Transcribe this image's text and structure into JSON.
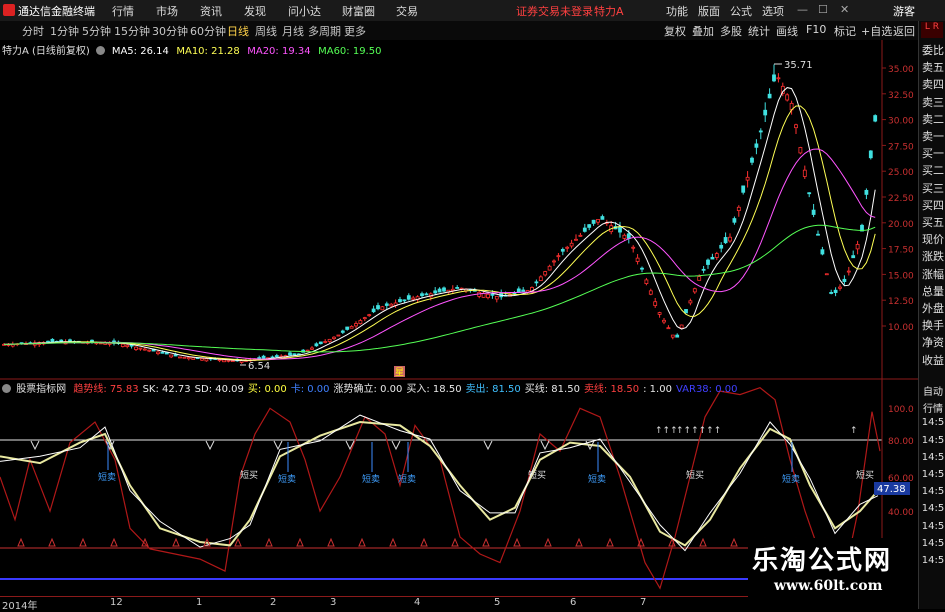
{
  "topbar": {
    "app_title": "通达信金融终端",
    "menu": [
      "行情",
      "市场",
      "资讯",
      "发现",
      "问小达",
      "财富圈",
      "交易"
    ],
    "login_status": "证券交易未登录",
    "stock_name": "特力A",
    "right_menu": [
      "功能",
      "版面",
      "公式",
      "选项"
    ],
    "guest": "游客"
  },
  "periods": [
    "分时",
    "1分钟",
    "5分钟",
    "15分钟",
    "30分钟",
    "60分钟",
    "日线",
    "周线",
    "月线",
    "多周期",
    "更多"
  ],
  "active_period": "日线",
  "tools": [
    "复权",
    "叠加",
    "多股",
    "统计",
    "画线",
    "F10",
    "标记",
    "+自选",
    "返回"
  ],
  "main_chart": {
    "title": "特力A (日线前复权)",
    "ma": [
      {
        "label": "MA5: 26.14",
        "color": "#ffffff"
      },
      {
        "label": "MA10: 21.28",
        "color": "#ffff55"
      },
      {
        "label": "MA20: 19.34",
        "color": "#ff55ff"
      },
      {
        "label": "MA60: 19.50",
        "color": "#55ff55"
      }
    ],
    "high_label": "35.71",
    "low_label": "6.54",
    "event_marker": "星",
    "y_ticks": [
      "35.00",
      "32.50",
      "30.00",
      "27.50",
      "25.00",
      "22.50",
      "20.00",
      "17.50",
      "15.00",
      "12.50",
      "10.00"
    ]
  },
  "indicator": {
    "name": "股票指标网",
    "items": [
      {
        "label": "趋势线: 75.83",
        "color": "#ff4040"
      },
      {
        "label": "SK: 42.73",
        "color": "#e8e8e8"
      },
      {
        "label": "SD: 40.09",
        "color": "#e8e8e8"
      },
      {
        "label": "买: 0.00",
        "color": "#ffff40"
      },
      {
        "label": "卡: 0.00",
        "color": "#4080ff"
      },
      {
        "label": "涨势确立: 0.00",
        "color": "#e8e8e8"
      },
      {
        "label": "买入: 18.50",
        "color": "#e8e8e8"
      },
      {
        "label": "卖出: 81.50",
        "color": "#40c0ff"
      },
      {
        "label": "买线: 81.50",
        "color": "#e8e8e8"
      },
      {
        "label": "卖线: 18.50",
        "color": "#ff4040"
      },
      {
        "label": ": 1.00",
        "color": "#e8e8e8"
      },
      {
        "label": "VAR38: 0.00",
        "color": "#4040ff"
      }
    ],
    "buy_label": "短买",
    "sell_label": "短卖",
    "arrow_text": "↑↑↑",
    "arrow_text2": "↑↑↑↑↑↑",
    "arrow_text3": "↑",
    "y_ticks": [
      "100.0",
      "80.00",
      "60.00",
      "40.00"
    ],
    "current_value": "47.38"
  },
  "right_panel_items": [
    "委比",
    "卖五",
    "卖四",
    "卖三",
    "卖二",
    "卖一",
    "买一",
    "买二",
    "买三",
    "买四",
    "买五",
    "现价",
    "涨跌",
    "涨幅",
    "总量",
    "外盘",
    "换手",
    "净资",
    "收益"
  ],
  "right_panel_bottom": [
    "自动",
    "行情",
    "14:5",
    "14:5",
    "14:5",
    "14:5",
    "14:5",
    "14:5",
    "14:5",
    "14:5",
    "14:5"
  ],
  "time_axis": [
    "2014年",
    "12",
    "1",
    "2",
    "3",
    "4",
    "5",
    "6",
    "7"
  ],
  "watermark": {
    "title": "乐淘公式网",
    "url": "www.60lt.com"
  }
}
